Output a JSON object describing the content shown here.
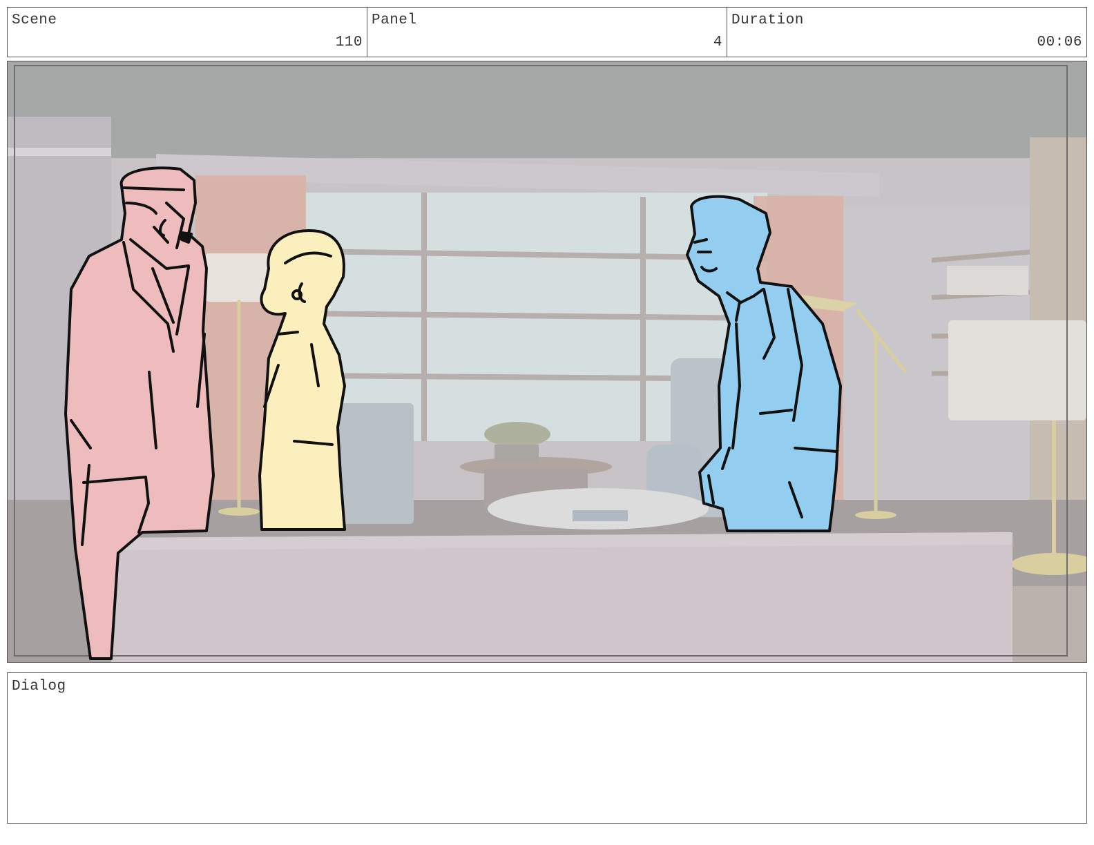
{
  "header": {
    "scene_label": "Scene",
    "scene_value": "110",
    "panel_label": "Panel",
    "panel_value": "4",
    "duration_label": "Duration",
    "duration_value": "00:06"
  },
  "dialog": {
    "label": "Dialog",
    "text": ""
  },
  "colors": {
    "character_left": "#eebcbc",
    "character_center": "#fcefbe",
    "character_right": "#93cdf0",
    "ink": "#111111"
  }
}
